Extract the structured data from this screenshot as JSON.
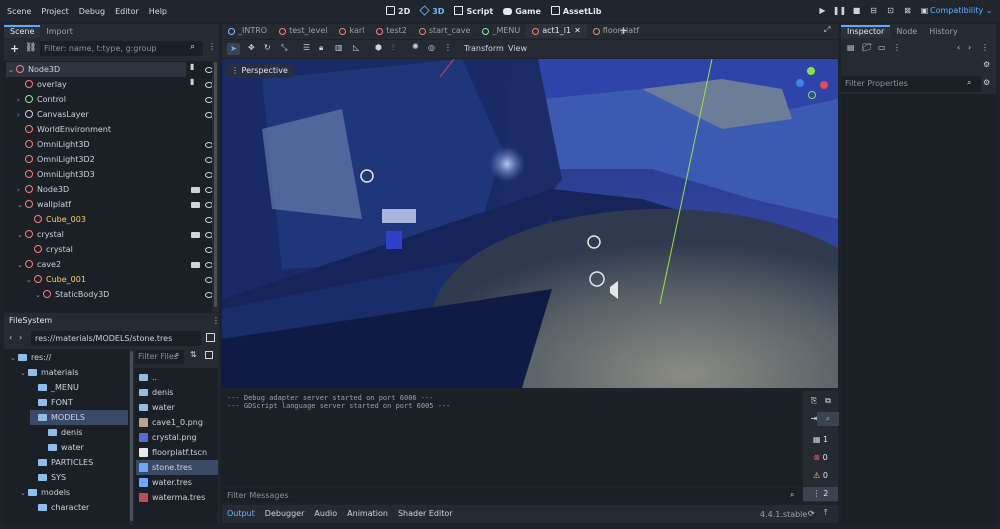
{
  "menu": [
    "Scene",
    "Project",
    "Debug",
    "Editor",
    "Help"
  ],
  "workspaces": [
    "2D",
    "3D",
    "Script",
    "Game",
    "AssetLib"
  ],
  "renderer": "Compatibility",
  "scene_dock": {
    "tabs": [
      "Scene",
      "Import"
    ],
    "filter_placeholder": "Filter: name, t:type, g:group",
    "nodes": [
      {
        "label": "Node3D",
        "indent": 0,
        "arrow": "⌄",
        "color": "#fc7f7f"
      },
      {
        "label": "overlay",
        "indent": 1,
        "arrow": "",
        "color": "#fc7f7f"
      },
      {
        "label": "Control",
        "indent": 1,
        "arrow": "›",
        "color": "#8eef97"
      },
      {
        "label": "CanvasLayer",
        "indent": 1,
        "arrow": "›",
        "color": "#cfd4dc"
      },
      {
        "label": "WorldEnvironment",
        "indent": 1,
        "arrow": "",
        "color": "#fc7f7f"
      },
      {
        "label": "OmniLight3D",
        "indent": 1,
        "arrow": "",
        "color": "#fc7f7f"
      },
      {
        "label": "OmniLight3D2",
        "indent": 1,
        "arrow": "",
        "color": "#fc7f7f"
      },
      {
        "label": "OmniLight3D3",
        "indent": 1,
        "arrow": "",
        "color": "#fc7f7f"
      },
      {
        "label": "Node3D",
        "indent": 1,
        "arrow": "›",
        "color": "#fc7f7f"
      },
      {
        "label": "wallplatf",
        "indent": 1,
        "arrow": "⌄",
        "color": "#fc7f7f"
      },
      {
        "label": "Cube_003",
        "indent": 2,
        "arrow": "",
        "color": "#fc7f7f",
        "highlight": true
      },
      {
        "label": "crystal",
        "indent": 1,
        "arrow": "⌄",
        "color": "#fc7f7f"
      },
      {
        "label": "crystal",
        "indent": 2,
        "arrow": "",
        "color": "#fc7f7f"
      },
      {
        "label": "cave2",
        "indent": 1,
        "arrow": "⌄",
        "color": "#fc7f7f"
      },
      {
        "label": "Cube_001",
        "indent": 2,
        "arrow": "⌄",
        "color": "#fc7f7f",
        "highlight": true
      },
      {
        "label": "StaticBody3D",
        "indent": 3,
        "arrow": "⌄",
        "color": "#fc7f7f"
      }
    ]
  },
  "filesystem": {
    "title": "FileSystem",
    "path": "res://materials/MODELS/stone.tres",
    "tree": [
      {
        "label": "res://",
        "indent": 0
      },
      {
        "label": "materials",
        "indent": 1
      },
      {
        "label": "_MENU",
        "indent": 2
      },
      {
        "label": "FONT",
        "indent": 2
      },
      {
        "label": "MODELS",
        "indent": 2,
        "selected": true
      },
      {
        "label": "denis",
        "indent": 3
      },
      {
        "label": "water",
        "indent": 3
      },
      {
        "label": "PARTICLES",
        "indent": 2
      },
      {
        "label": "SYS",
        "indent": 2
      },
      {
        "label": "models",
        "indent": 1
      },
      {
        "label": "character",
        "indent": 2
      }
    ],
    "filter_placeholder": "Filter Files",
    "files": [
      {
        "label": "..",
        "kind": "folder"
      },
      {
        "label": "denis",
        "kind": "folder"
      },
      {
        "label": "water",
        "kind": "folder"
      },
      {
        "label": "cave1_0.png",
        "kind": "image"
      },
      {
        "label": "crystal.png",
        "kind": "image2"
      },
      {
        "label": "floorplatf.tscn",
        "kind": "scene"
      },
      {
        "label": "stone.tres",
        "kind": "res",
        "selected": true
      },
      {
        "label": "water.tres",
        "kind": "res"
      },
      {
        "label": "waterma.tres",
        "kind": "res2"
      }
    ]
  },
  "scene_tabs": [
    "_INTRO",
    "test_level",
    "karl",
    "test2",
    "start_cave",
    "_MENU",
    "act1_l1",
    "floorplatf"
  ],
  "active_scene_tab": "act1_l1",
  "viewport": {
    "perspective": "Perspective",
    "menus": [
      "Transform",
      "View"
    ]
  },
  "output": {
    "lines": [
      "--- Debug adapter server started on port 6006 ---",
      "--- GDScript language server started on port 6005 ---"
    ],
    "filter_placeholder": "Filter Messages",
    "counts": {
      "messages": "1",
      "errors": "0",
      "warnings": "0",
      "info": "2"
    },
    "bottom_tabs": [
      "Output",
      "Debugger",
      "Audio",
      "Animation",
      "Shader Editor"
    ],
    "version": "4.4.1.stable"
  },
  "inspector": {
    "tabs": [
      "Inspector",
      "Node",
      "History"
    ],
    "filter_placeholder": "Filter Properties"
  }
}
